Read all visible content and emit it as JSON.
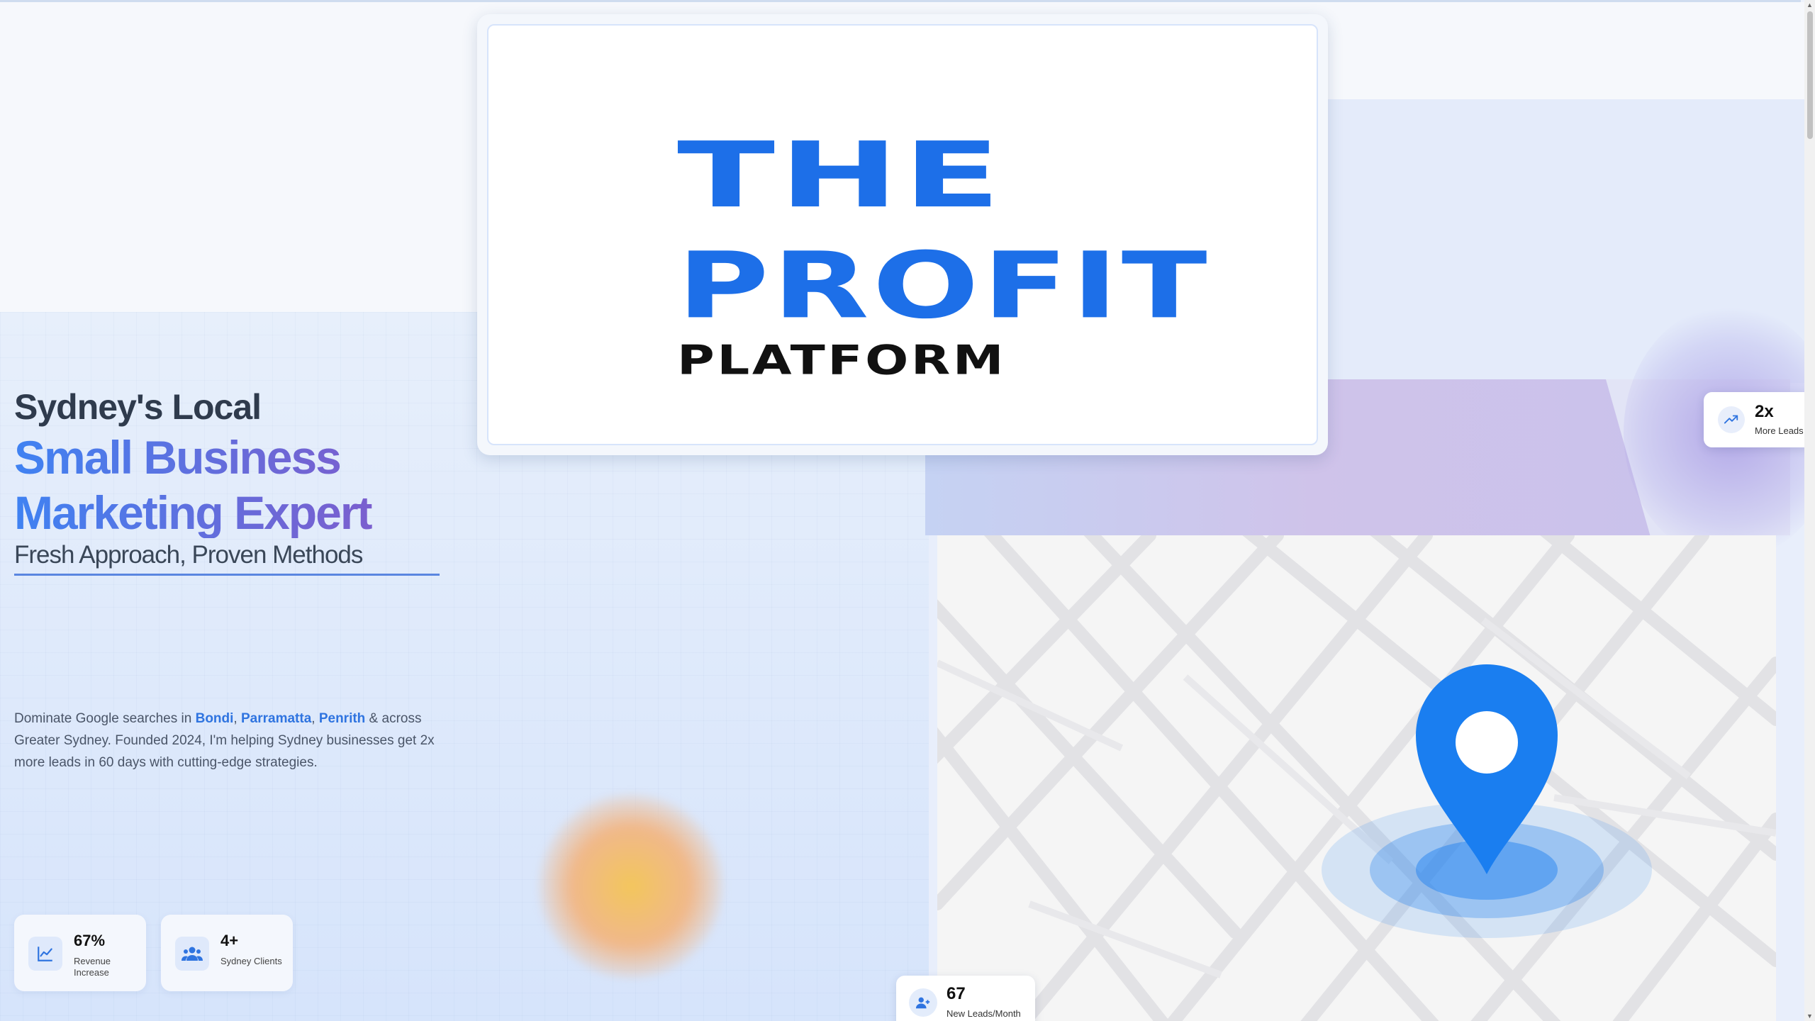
{
  "logo": {
    "line1": "THE",
    "line2": "PROFIT",
    "line3": "PLATFORM"
  },
  "hero": {
    "title_line1": "Sydney's Local",
    "title_line2": "Small Business",
    "title_line3": "Marketing Expert",
    "tagline": "Fresh Approach, Proven Methods"
  },
  "description": {
    "prefix": "Dominate Google searches in ",
    "suburb1": "Bondi",
    "sep1": ", ",
    "suburb2": "Parramatta",
    "sep2": ", ",
    "suburb3": "Penrith",
    "suffix": " & across Greater Sydney. Founded 2024, I'm helping Sydney businesses get 2x more leads in 60 days with cutting-edge strategies."
  },
  "stats": [
    {
      "value": "67%",
      "label": "Revenue Increase",
      "icon": "chart-line-icon"
    },
    {
      "value": "4+",
      "label": "Sydney Clients",
      "icon": "users-icon"
    }
  ],
  "floating_cards": {
    "leads": {
      "value": "67",
      "label": "New Leads/Month",
      "icon": "user-plus-icon"
    },
    "more": {
      "value": "2x",
      "label": "More Leads",
      "icon": "trending-up-icon"
    }
  },
  "colors": {
    "brand_blue": "#1d6fe8",
    "accent_purple": "#8658c8",
    "pin_blue": "#1a7ef0"
  }
}
